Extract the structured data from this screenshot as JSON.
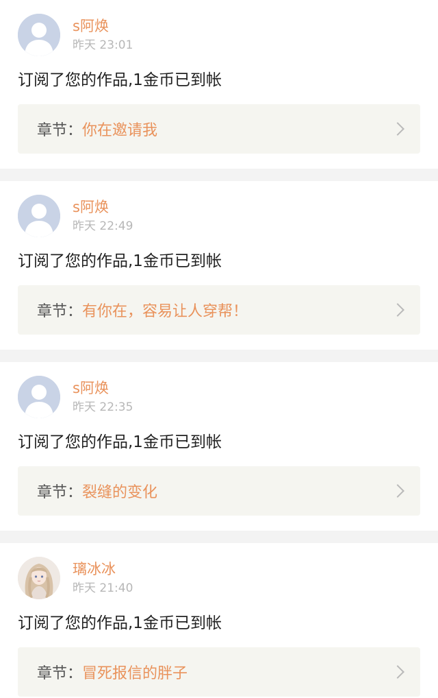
{
  "notifications": [
    {
      "username": "s阿焕",
      "time": "昨天 23:01",
      "message": "订阅了您的作品,1金币已到帐",
      "chapter_prefix": "章节：",
      "chapter_title": "你在邀请我",
      "avatar_icon": "default-user-avatar-icon"
    },
    {
      "username": "s阿焕",
      "time": "昨天 22:49",
      "message": "订阅了您的作品,1金币已到帐",
      "chapter_prefix": "章节：",
      "chapter_title": "有你在，容易让人穿帮！",
      "avatar_icon": "default-user-avatar-icon"
    },
    {
      "username": "s阿焕",
      "time": "昨天 22:35",
      "message": "订阅了您的作品,1金币已到帐",
      "chapter_prefix": "章节：",
      "chapter_title": "裂缝的变化",
      "avatar_icon": "default-user-avatar-icon"
    },
    {
      "username": "璃冰冰",
      "time": "昨天 21:40",
      "message": "订阅了您的作品,1金币已到帐",
      "chapter_prefix": "章节：",
      "chapter_title": "冒死报信的胖子",
      "avatar_icon": "anime-girl-avatar-icon"
    }
  ],
  "colors": {
    "accent": "#e9925b",
    "time": "#b7b7b7",
    "chapter_bg": "#f5f5f0",
    "divider": "#f3f3f3"
  }
}
